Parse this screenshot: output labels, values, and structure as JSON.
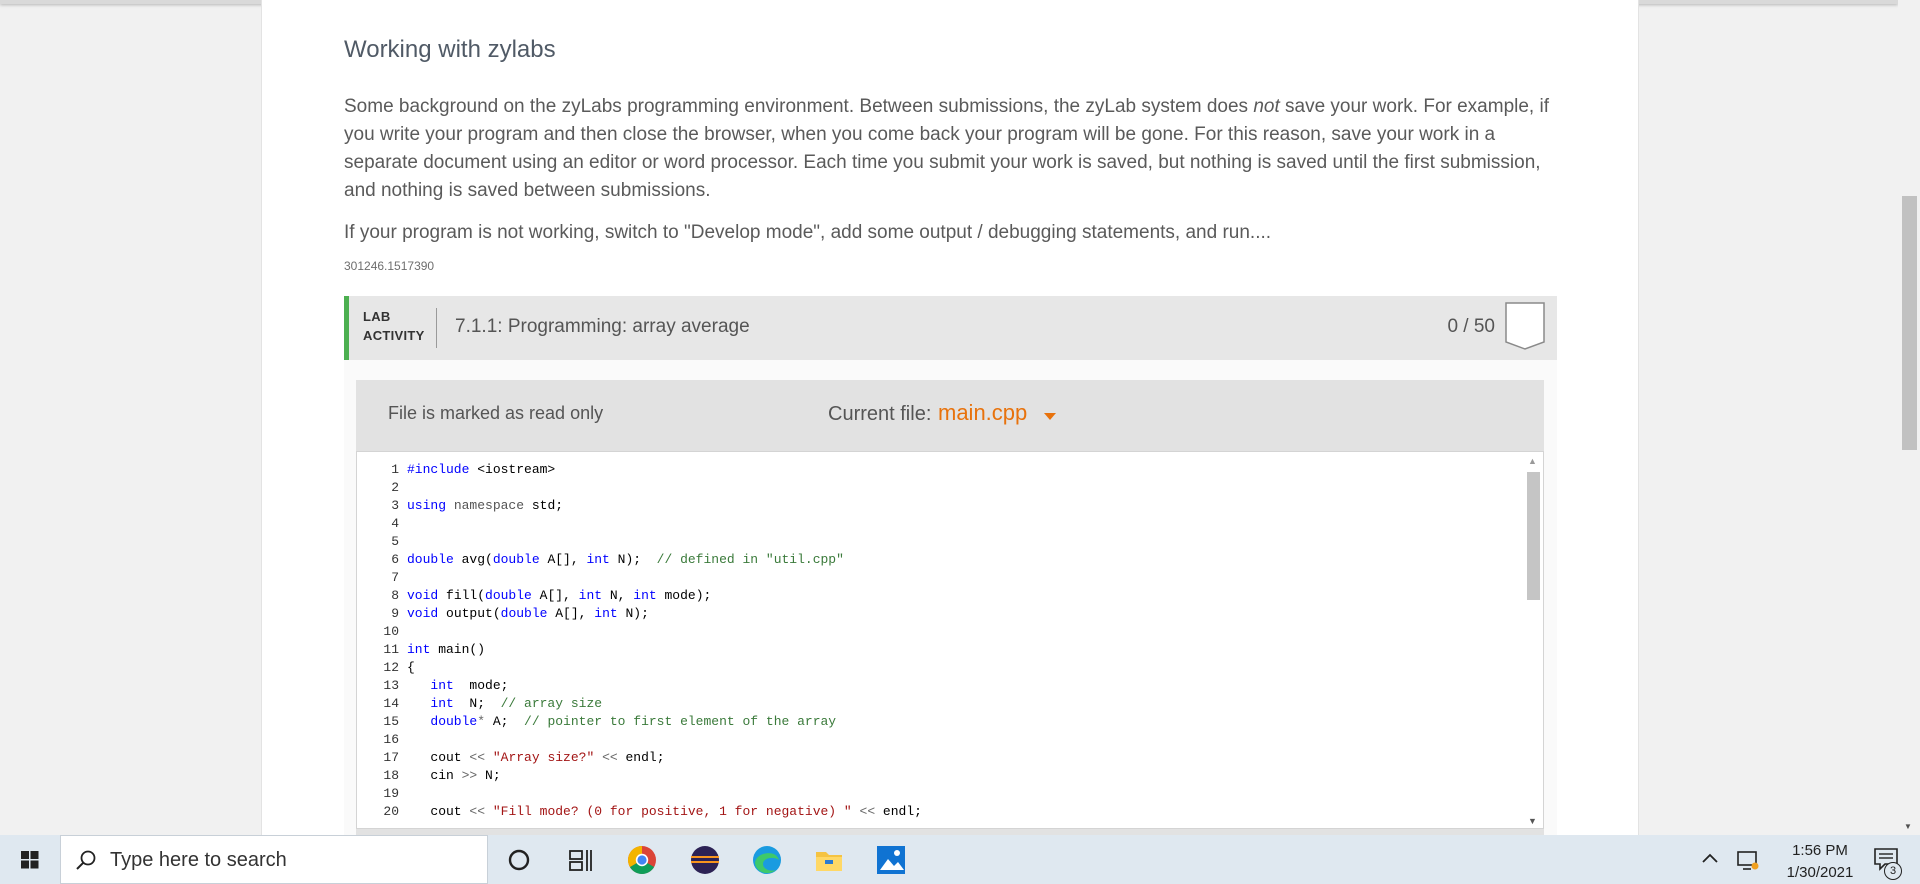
{
  "section": {
    "title": "Working with zylabs",
    "paragraph1_before": "Some background on the zyLabs programming environment. Between submissions, the zyLab system does ",
    "paragraph1_em": "not",
    "paragraph1_after": " save your work. For example, if you write your program and then close the browser, when you come back your program will be gone. For this reason, save your work in a separate document using an editor or word processor. Each time you submit your work is saved, but nothing is saved until the first submission, and nothing is saved between submissions.",
    "paragraph2": "If your program is not working, switch to \"Develop mode\", add some output / debugging statements, and run....",
    "ref_id": "301246.1517390"
  },
  "lab": {
    "tag_line1": "LAB",
    "tag_line2": "ACTIVITY",
    "title": "7.1.1: Programming: array average",
    "score": "0 / 50",
    "accent_color": "#4caf50"
  },
  "editor": {
    "readonly_text": "File is marked as read only",
    "current_file_label": "Current file:",
    "current_file": "main.cpp",
    "file_color": "#e8720c"
  },
  "code_lines": [
    {
      "n": "1",
      "html": "<span class=\"kw\">#include</span> &lt;iostream&gt;"
    },
    {
      "n": "2",
      "html": ""
    },
    {
      "n": "3",
      "html": "<span class=\"kw\">using</span> <span class=\"ns\">namespace</span> std;"
    },
    {
      "n": "4",
      "html": ""
    },
    {
      "n": "5",
      "html": ""
    },
    {
      "n": "6",
      "html": "<span class=\"kw\">double</span> avg(<span class=\"kw\">double</span> A[], <span class=\"kw\">int</span> N);  <span class=\"cmt\">// defined in \"util.cpp\"</span>"
    },
    {
      "n": "7",
      "html": ""
    },
    {
      "n": "8",
      "html": "<span class=\"kw\">void</span> fill(<span class=\"kw\">double</span> A[], <span class=\"kw\">int</span> N, <span class=\"kw\">int</span> mode);"
    },
    {
      "n": "9",
      "html": "<span class=\"kw\">void</span> output(<span class=\"kw\">double</span> A[], <span class=\"kw\">int</span> N);"
    },
    {
      "n": "10",
      "html": ""
    },
    {
      "n": "11",
      "html": "<span class=\"kw\">int</span> main()"
    },
    {
      "n": "12",
      "html": "{"
    },
    {
      "n": "13",
      "html": "   <span class=\"kw\">int</span>  mode;"
    },
    {
      "n": "14",
      "html": "   <span class=\"kw\">int</span>  N;  <span class=\"cmt\">// array size</span>"
    },
    {
      "n": "15",
      "html": "   <span class=\"kw\">double</span><span class=\"op\">*</span> A;  <span class=\"cmt\">// pointer to first element of the array</span>"
    },
    {
      "n": "16",
      "html": ""
    },
    {
      "n": "17",
      "html": "   cout <span class=\"op\">&lt;&lt;</span> <span class=\"str\">\"Array size?\"</span> <span class=\"op\">&lt;&lt;</span> endl;"
    },
    {
      "n": "18",
      "html": "   cin <span class=\"op\">&gt;&gt;</span> N;"
    },
    {
      "n": "19",
      "html": ""
    },
    {
      "n": "20",
      "html": "   cout <span class=\"op\">&lt;&lt;</span> <span class=\"str\">\"Fill mode? (0 for positive, 1 for negative) \"</span> <span class=\"op\">&lt;&lt;</span> endl;"
    }
  ],
  "taskbar": {
    "search_placeholder": "Type here to search",
    "apps": [
      "task-view-icon",
      "chrome-icon",
      "eclipse-icon",
      "edge-icon",
      "file-explorer-icon",
      "photos-icon"
    ],
    "time": "1:56 PM",
    "date": "1/30/2021",
    "notification_count": "3"
  }
}
